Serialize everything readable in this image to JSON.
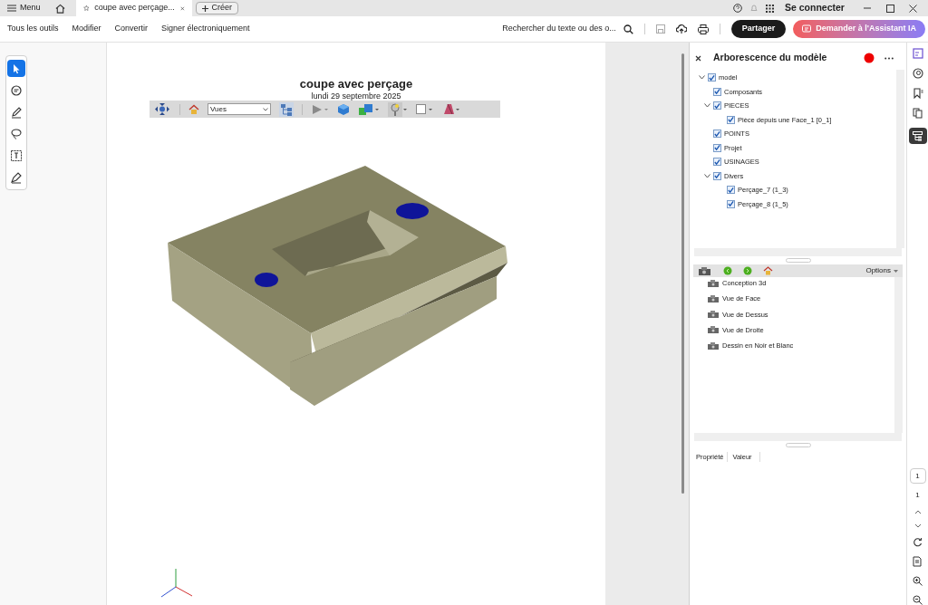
{
  "tab_bar": {
    "menu": "Menu",
    "tab_title": "coupe avec perçage...",
    "create": "Créer",
    "sign_in": "Se connecter"
  },
  "toolbar": {
    "menus": [
      "Tous les outils",
      "Modifier",
      "Convertir",
      "Signer électroniquement"
    ],
    "search": "Rechercher du texte ou des o...",
    "share": "Partager",
    "ai": "Demander à l'Assistant IA"
  },
  "tools": [
    {
      "kind": "pointer",
      "selected": true
    },
    {
      "kind": "comment",
      "selected": false
    },
    {
      "kind": "pen",
      "selected": false
    },
    {
      "kind": "lasso",
      "selected": false
    },
    {
      "kind": "text",
      "selected": false
    },
    {
      "kind": "stamp",
      "selected": false
    }
  ],
  "document": {
    "title": "coupe avec perçage",
    "date": "lundi 29 septembre 2025",
    "view_select": "Vues"
  },
  "model_tree": {
    "title": "Arborescence du modèle",
    "items": [
      {
        "label": "model",
        "checked": true,
        "expanded": true,
        "children": [
          {
            "label": "Composants",
            "checked": true
          },
          {
            "label": "PIECES",
            "checked": true,
            "expanded": true,
            "children": [
              {
                "label": "Pièce depuis une Face_1 [0_1]",
                "checked": true
              }
            ]
          },
          {
            "label": "POINTS",
            "checked": true
          },
          {
            "label": "Projet",
            "checked": true
          },
          {
            "label": "USINAGES",
            "checked": true
          },
          {
            "label": "Divers",
            "checked": true,
            "expanded": true,
            "children": [
              {
                "label": "Perçage_7 (1_3)",
                "checked": true
              },
              {
                "label": "Perçage_8 (1_5)",
                "checked": true
              }
            ]
          }
        ]
      }
    ]
  },
  "views": {
    "options": "Options",
    "items": [
      "Conception 3d",
      "Vue de Face",
      "Vue de Dessus",
      "Vue de Droite",
      "Dessin en Noir et Blanc"
    ]
  },
  "properties": {
    "columns": [
      "Propriété",
      "Valeur"
    ]
  },
  "page_nav": {
    "page_field": "1",
    "page_count": "1"
  }
}
